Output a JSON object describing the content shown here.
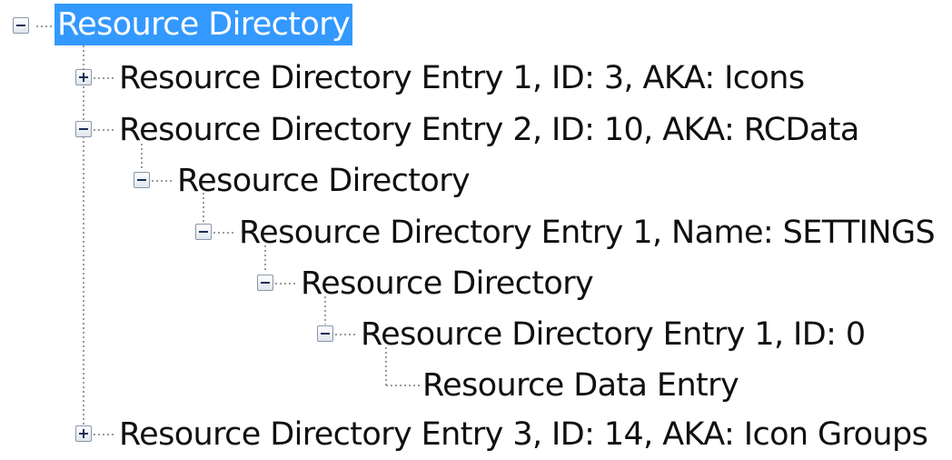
{
  "tree": {
    "root": {
      "label": "Resource Directory",
      "expanded": true,
      "selected": true
    },
    "items": [
      {
        "label": "Resource Directory Entry 1, ID: 3, AKA: Icons",
        "expanded": false
      },
      {
        "label": "Resource Directory Entry 2, ID: 10, AKA: RCData",
        "expanded": true
      },
      {
        "label": "Resource Directory",
        "expanded": true
      },
      {
        "label": "Resource Directory Entry 1, Name: SETTINGS",
        "expanded": true
      },
      {
        "label": "Resource Directory",
        "expanded": true
      },
      {
        "label": "Resource Directory Entry 1, ID: 0",
        "expanded": true
      },
      {
        "label": "Resource Data Entry",
        "leaf": true
      },
      {
        "label": "Resource Directory Entry 3, ID: 14, AKA: Icon Groups",
        "expanded": false
      }
    ]
  },
  "colors": {
    "selection_bg": "#3399ff",
    "selection_text": "#ffffff",
    "connector": "#9a9a9a"
  },
  "icons": {
    "expanded": "collapse-box-icon",
    "collapsed": "expand-box-icon"
  }
}
